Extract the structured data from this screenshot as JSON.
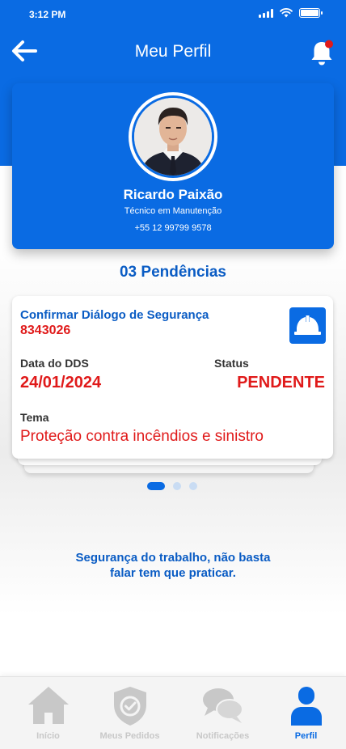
{
  "status_bar": {
    "time": "3:12 PM",
    "icons": [
      "signal-icon",
      "wifi-icon",
      "battery-icon"
    ]
  },
  "header": {
    "title": "Meu Perfil",
    "back_icon": "arrow-left-icon",
    "notification_icon": "bell-icon",
    "notification_has_badge": true
  },
  "profile": {
    "name": "Ricardo Paixão",
    "role": "Técnico em Manutenção",
    "phone": "+55 12 99799 9578"
  },
  "pending": {
    "title": "03 Pendências",
    "cards": [
      {
        "title": "Confirmar Diálogo de Segurança",
        "code": "8343026",
        "date_label": "Data do DDS",
        "date_value": "24/01/2024",
        "status_label": "Status",
        "status_value": "PENDENTE",
        "tema_label": "Tema",
        "tema_value": "Proteção contra incêndios e sinistro",
        "icon": "hard-hat-icon"
      }
    ],
    "carousel": {
      "count": 3,
      "active_index": 0
    }
  },
  "motto": {
    "line1": "Segurança do trabalho, não basta",
    "line2": "falar tem que praticar."
  },
  "bottom_nav": {
    "items": [
      {
        "label": "Início",
        "icon": "home-icon",
        "active": false
      },
      {
        "label": "Meus Pedidos",
        "icon": "shield-check-icon",
        "active": false
      },
      {
        "label": "Notificações",
        "icon": "chat-bubbles-icon",
        "active": false
      },
      {
        "label": "Perfil",
        "icon": "user-icon",
        "active": true
      }
    ]
  },
  "colors": {
    "primary": "#0a6be3",
    "primary_dark": "#0a5cc4",
    "alert_red": "#e01a1a",
    "inactive_gray": "#c8c8c8"
  }
}
